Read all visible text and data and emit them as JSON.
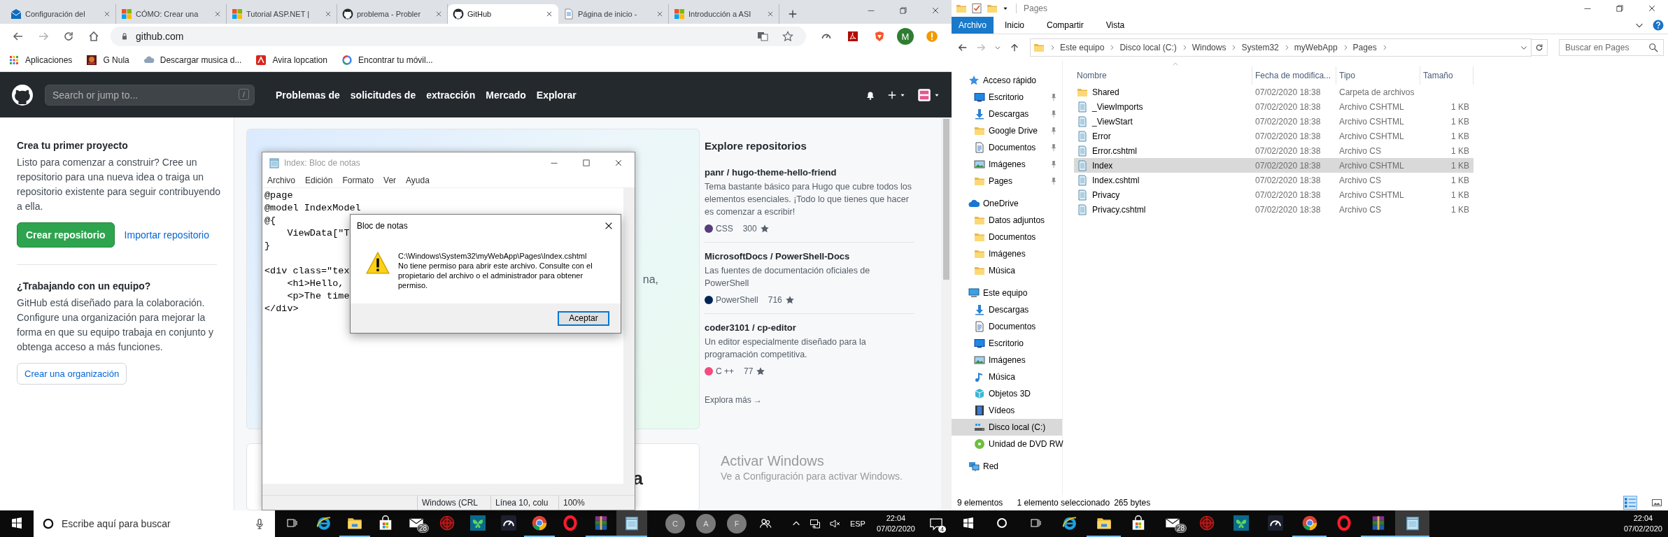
{
  "browser": {
    "tabs": [
      {
        "title": "Configuración del",
        "kind": "mail",
        "selected": false
      },
      {
        "title": "CÓMO: Crear una",
        "kind": "windows",
        "selected": false
      },
      {
        "title": "Tutorial ASP.NET |",
        "kind": "windows",
        "selected": false
      },
      {
        "title": "problema - Probler",
        "kind": "github",
        "selected": false
      },
      {
        "title": "GitHub",
        "kind": "github",
        "selected": true
      },
      {
        "title": "Página de inicio -",
        "kind": "page",
        "selected": false
      },
      {
        "title": "Introducción a ASI",
        "kind": "windows",
        "selected": false
      }
    ],
    "address": "github.com",
    "profile": "M",
    "bookmarks": [
      {
        "label": "Aplicaciones",
        "kind": "apps"
      },
      {
        "label": "G Nula",
        "kind": "thumb"
      },
      {
        "label": "Descargar musica d...",
        "kind": "cloud"
      },
      {
        "label": "Avira lopcation",
        "kind": "avira"
      },
      {
        "label": "Encontrar tu móvil...",
        "kind": "google"
      }
    ]
  },
  "github": {
    "search_placeholder": "Search or jump to...",
    "search_key": "/",
    "nav": [
      "Problemas de",
      "solicitudes de",
      "extracción",
      "Mercado",
      "Explorar"
    ],
    "sidebar": [
      {
        "title": "Crea tu primer proyecto",
        "text": "Listo para comenzar a construir? Cree un repositorio para una nueva idea o traiga un repositorio existente para seguir contribuyendo a ella.",
        "buttons": [
          {
            "label": "Crear repositorio",
            "kind": "primary"
          },
          {
            "label": "Importar repositorio",
            "kind": "link"
          }
        ]
      },
      {
        "title": "¿Trabajando con un equipo?",
        "text": "GitHub está diseñado para la colaboración. Configure una organización para mejorar la forma en que su equipo trabaja en conjunto y obtenga acceso a más funciones.",
        "buttons": [
          {
            "label": "Crear una organización",
            "kind": "outline"
          }
        ]
      }
    ],
    "hero_fragments": [
      {
        "text": "na,",
        "kind": "body"
      },
      {
        "text": "a",
        "kind": "heading"
      }
    ],
    "explore": {
      "title": "Explore repositorios",
      "repos": [
        {
          "name": "panr / hugo-theme-hello-friend",
          "description": "Tema bastante básico para Hugo que cubre todos los elementos esenciales. ¡Todo lo que tienes que hacer es comenzar a escribir!",
          "language": "CSS",
          "color": "#563d7c",
          "stars": "300"
        },
        {
          "name": "MicrosoftDocs / PowerShell-Docs",
          "description": "Las fuentes de documentación oficiales de PowerShell",
          "language": "PowerShell",
          "color": "#012456",
          "stars": "716"
        },
        {
          "name": "coder3101 / cp-editor",
          "description": "Un editor especialmente diseñado para la programación competitiva.",
          "language": "C ++",
          "color": "#f34b7d",
          "stars": "77"
        }
      ],
      "more": "Explora más →"
    }
  },
  "notepad": {
    "title": "Index: Bloc de notas",
    "menu": [
      "Archivo",
      "Edición",
      "Formato",
      "Ver",
      "Ayuda"
    ],
    "blocks": [
      [
        "@page",
        "@model IndexModel",
        "@{",
        "    ViewData[\"T",
        "}"
      ],
      [
        "<div class=\"tex",
        "    <h1>Hello,",
        "    <p>The time",
        "</div>"
      ]
    ],
    "status": [
      "Windows (CRL",
      "Línea 10, colu",
      "100%"
    ]
  },
  "dialog": {
    "title": "Bloc de notas",
    "path": "C:\\Windows\\System32\\myWebApp\\Pages\\Index.cshtml",
    "message": "No tiene permiso para abrir este archivo. Consulte con el propietario del archivo o el administrador para obtener permiso.",
    "button": "Aceptar"
  },
  "activation": {
    "title": "Activar Windows",
    "subtitle": "Ve a Configuración para activar Windows."
  },
  "taskbar_left": {
    "search_placeholder": "Escribe aquí para buscar",
    "apps": [
      {
        "kind": "ie",
        "running": false,
        "active": false
      },
      {
        "kind": "explorer",
        "running": true,
        "active": false
      },
      {
        "kind": "store",
        "running": false,
        "active": false
      },
      {
        "kind": "mail",
        "badge": "28",
        "running": false,
        "active": false
      },
      {
        "kind": "target",
        "running": false,
        "active": false
      },
      {
        "kind": "butterfly",
        "running": false,
        "active": false
      },
      {
        "kind": "gauge",
        "running": false,
        "active": false
      },
      {
        "kind": "chrome",
        "running": true,
        "active": false
      },
      {
        "kind": "opera",
        "running": false,
        "active": false
      },
      {
        "kind": "winrar",
        "running": true,
        "active": false
      },
      {
        "kind": "notepad",
        "running": true,
        "active": true
      }
    ],
    "people": [
      "C",
      "A",
      "F"
    ],
    "language": "ESP",
    "time": "22:04",
    "date": "07/02/2020",
    "notifications": "4"
  },
  "explorer": {
    "title": "Pages",
    "ribbon_tabs": [
      {
        "label": "Archivo",
        "kind": "file"
      },
      {
        "label": "Inicio",
        "kind": "tab"
      },
      {
        "label": "Compartir",
        "kind": "tab"
      },
      {
        "label": "Vista",
        "kind": "tab"
      }
    ],
    "breadcrumb": [
      "Este equipo",
      "Disco local (C:)",
      "Windows",
      "System32",
      "myWebApp",
      "Pages"
    ],
    "search_placeholder": "Buscar en Pages",
    "nav": [
      {
        "label": "Acceso rápido",
        "kind": "star",
        "selected": false,
        "children": [
          {
            "label": "Escritorio",
            "kind": "desktop",
            "pinned": true,
            "selected": false
          },
          {
            "label": "Descargas",
            "kind": "download",
            "pinned": true,
            "selected": false
          },
          {
            "label": "Google Drive",
            "kind": "folder",
            "pinned": true,
            "selected": false
          },
          {
            "label": "Documentos",
            "kind": "document",
            "pinned": true,
            "selected": false
          },
          {
            "label": "Imágenes",
            "kind": "image",
            "pinned": true,
            "selected": false
          },
          {
            "label": "Pages",
            "kind": "folder",
            "pinned": true,
            "selected": false
          }
        ]
      },
      {
        "label": "OneDrive",
        "kind": "cloud",
        "selected": false,
        "children": [
          {
            "label": "Datos adjuntos",
            "kind": "folder",
            "selected": false
          },
          {
            "label": "Documentos",
            "kind": "folder",
            "selected": false
          },
          {
            "label": "Imágenes",
            "kind": "folder",
            "selected": false
          },
          {
            "label": "Música",
            "kind": "folder",
            "selected": false
          }
        ]
      },
      {
        "label": "Este equipo",
        "kind": "computer",
        "selected": false,
        "children": [
          {
            "label": "Descargas",
            "kind": "download",
            "selected": false
          },
          {
            "label": "Documentos",
            "kind": "document",
            "selected": false
          },
          {
            "label": "Escritorio",
            "kind": "desktop",
            "selected": false
          },
          {
            "label": "Imágenes",
            "kind": "image",
            "selected": false
          },
          {
            "label": "Música",
            "kind": "music",
            "selected": false
          },
          {
            "label": "Objetos 3D",
            "kind": "cube",
            "selected": false
          },
          {
            "label": "Vídeos",
            "kind": "film",
            "selected": false
          },
          {
            "label": "Disco local (C:)",
            "kind": "drive",
            "selected": true
          },
          {
            "label": "Unidad de DVD RW",
            "kind": "disc",
            "selected": false
          }
        ]
      },
      {
        "label": "Red",
        "kind": "network",
        "selected": false
      }
    ],
    "columns": [
      "Nombre",
      "Fecha de modifica...",
      "Tipo",
      "Tamaño"
    ],
    "files": [
      {
        "name": "Shared",
        "kind": "folder",
        "date": "07/02/2020 18:38",
        "type": "Carpeta de archivos",
        "selected": false
      },
      {
        "name": "_ViewImports",
        "kind": "file",
        "date": "07/02/2020 18:38",
        "type": "Archivo CSHTML",
        "size": "1 KB",
        "selected": false
      },
      {
        "name": "_ViewStart",
        "kind": "file",
        "date": "07/02/2020 18:38",
        "type": "Archivo CSHTML",
        "size": "1 KB",
        "selected": false
      },
      {
        "name": "Error",
        "kind": "file",
        "date": "07/02/2020 18:38",
        "type": "Archivo CSHTML",
        "size": "1 KB",
        "selected": false
      },
      {
        "name": "Error.cshtml",
        "kind": "file",
        "date": "07/02/2020 18:38",
        "type": "Archivo CS",
        "size": "1 KB",
        "selected": false
      },
      {
        "name": "Index",
        "kind": "file",
        "date": "07/02/2020 18:38",
        "type": "Archivo CSHTML",
        "size": "1 KB",
        "selected": true
      },
      {
        "name": "Index.cshtml",
        "kind": "file",
        "date": "07/02/2020 18:38",
        "type": "Archivo CS",
        "size": "1 KB",
        "selected": false
      },
      {
        "name": "Privacy",
        "kind": "file",
        "date": "07/02/2020 18:38",
        "type": "Archivo CSHTML",
        "size": "1 KB",
        "selected": false
      },
      {
        "name": "Privacy.cshtml",
        "kind": "file",
        "date": "07/02/2020 18:38",
        "type": "Archivo CS",
        "size": "1 KB",
        "selected": false
      }
    ],
    "status": [
      "9 elementos",
      "1 elemento seleccionado",
      "265 bytes"
    ]
  },
  "taskbar_right": {
    "apps": [
      {
        "kind": "ie",
        "running": false,
        "active": false
      },
      {
        "kind": "explorer",
        "running": true,
        "active": false
      },
      {
        "kind": "store",
        "running": false,
        "active": false
      },
      {
        "kind": "mail",
        "badge": "28",
        "running": false,
        "active": false
      },
      {
        "kind": "target",
        "running": false,
        "active": false
      },
      {
        "kind": "butterfly",
        "running": false,
        "active": false
      },
      {
        "kind": "gauge",
        "running": false,
        "active": false
      },
      {
        "kind": "chrome",
        "running": true,
        "active": false
      },
      {
        "kind": "opera",
        "running": false,
        "active": false
      },
      {
        "kind": "winrar",
        "running": true,
        "active": false
      },
      {
        "kind": "notepad",
        "running": true,
        "active": true
      }
    ],
    "time": "22:04",
    "date": "07/02/2020"
  }
}
